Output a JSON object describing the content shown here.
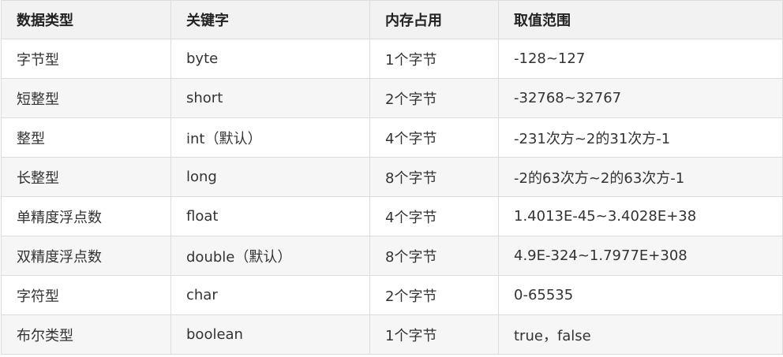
{
  "table": {
    "headers": [
      "数据类型",
      "关键字",
      "内存占用",
      "取值范围"
    ],
    "rows": [
      [
        "字节型",
        "byte",
        "1个字节",
        "-128~127"
      ],
      [
        "短整型",
        "short",
        "2个字节",
        "-32768~32767"
      ],
      [
        "整型",
        "int（默认）",
        "4个字节",
        "-231次方~2的31次方-1"
      ],
      [
        "长整型",
        "long",
        "8个字节",
        "-2的63次方~2的63次方-1"
      ],
      [
        "单精度浮点数",
        "float",
        "4个字节",
        "1.4013E-45~3.4028E+38"
      ],
      [
        "双精度浮点数",
        "double（默认）",
        "8个字节",
        "4.9E-324~1.7977E+308"
      ],
      [
        "字符型",
        "char",
        "2个字节",
        "0-65535"
      ],
      [
        "布尔类型",
        "boolean",
        "1个字节",
        "true，false"
      ]
    ]
  }
}
